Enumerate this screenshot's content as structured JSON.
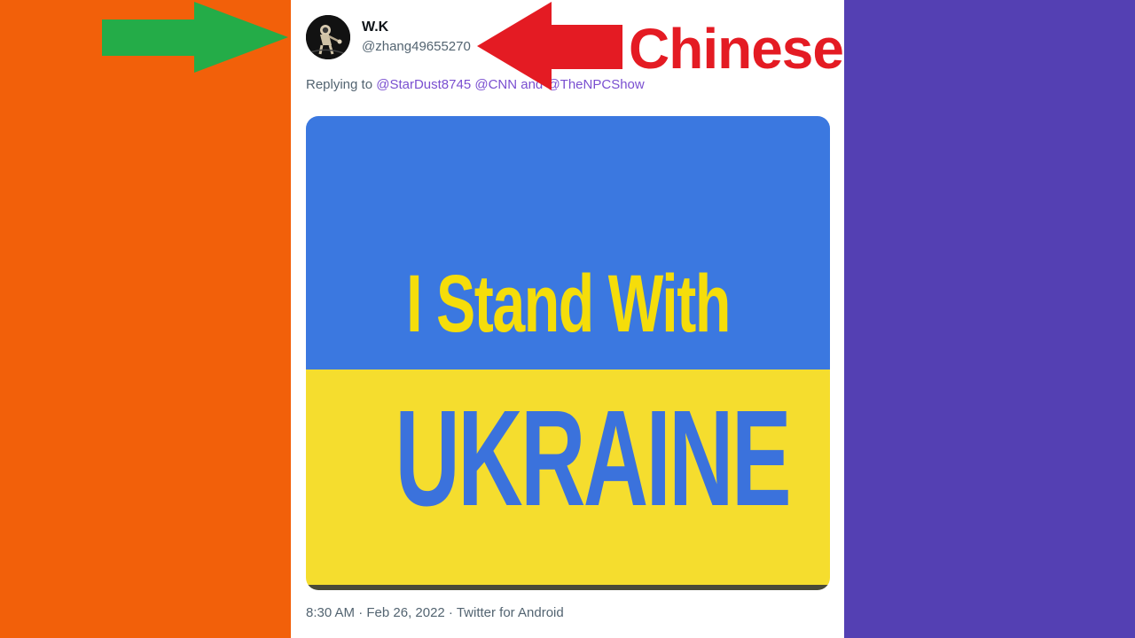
{
  "colors": {
    "left_panel": "#f2600a",
    "right_panel": "#5440b3",
    "flag_blue": "#3b78e0",
    "flag_yellow": "#f5dd2e",
    "text_yellow": "#f5dd0a",
    "text_blue": "#3b72dc",
    "arrow_green": "#24ac48",
    "arrow_red": "#e41b23"
  },
  "tweet": {
    "display_name": "W.K",
    "handle": "@zhang49655270",
    "reply_prefix": "Replying to ",
    "mention_1": "@StarDust8745",
    "mention_2": "@CNN",
    "and_text": "and",
    "mention_3": "@TheNPCShow",
    "image_line_1": "I Stand With",
    "image_line_2": "UKRAINE",
    "timestamp": "8:30 AM · Feb 26, 2022 · Twitter for Android"
  },
  "annotation": {
    "label": "Chinese"
  },
  "icons": {
    "avatar": "astronaut-avatar-icon",
    "green_arrow": "arrow-right-icon",
    "red_arrow": "arrow-left-icon"
  }
}
